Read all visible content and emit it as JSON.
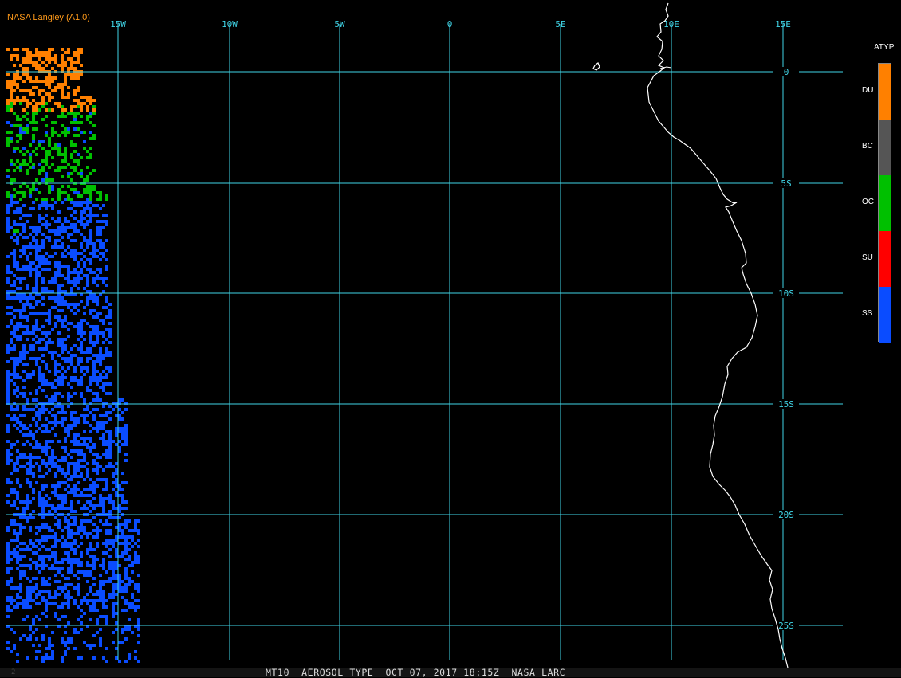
{
  "header": {
    "credit": "NASA Langley (A1.0)"
  },
  "map": {
    "longitude_labels": [
      "15W",
      "10W",
      "5W",
      "0",
      "5E",
      "10E",
      "15E"
    ],
    "latitude_labels": [
      "0",
      "5S",
      "10S",
      "15S",
      "20S",
      "25S"
    ],
    "grid_color": "#40d4e6",
    "coastline_color": "#ffffff"
  },
  "legend": {
    "title": "ATYP",
    "items": [
      {
        "label": "DU",
        "color": "#ff8000"
      },
      {
        "label": "BC",
        "color": "#555555"
      },
      {
        "label": "OC",
        "color": "#00c000"
      },
      {
        "label": "SU",
        "color": "#ff0000"
      },
      {
        "label": "SS",
        "color": "#0a4cff"
      }
    ]
  },
  "footer": {
    "caption": "MT10  AEROSOL TYPE  OCT 07, 2017 18:15Z  NASA LARC",
    "frame_number": "2"
  }
}
